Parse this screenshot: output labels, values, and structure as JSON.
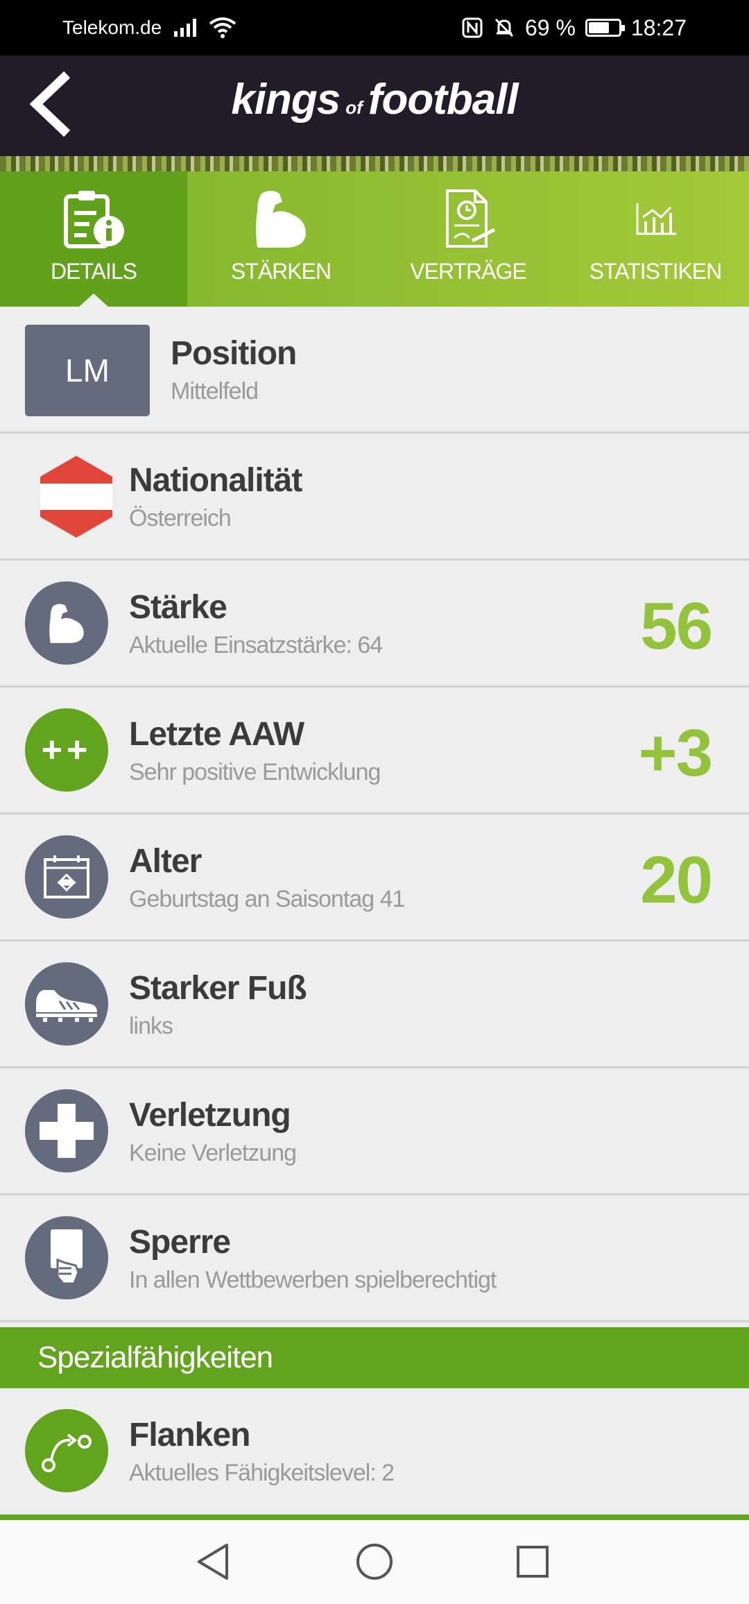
{
  "status_bar": {
    "carrier": "Telekom.de",
    "battery": "69 %",
    "battery_level": 0.69,
    "time": "18:27"
  },
  "header": {
    "brand_word1": "kings",
    "brand_word2": "of",
    "brand_word3": "football"
  },
  "tabs": [
    {
      "label": "DETAILS",
      "icon": "details-icon",
      "active": true
    },
    {
      "label": "STÄRKEN",
      "icon": "muscle-icon",
      "active": false
    },
    {
      "label": "VERTRÄGE",
      "icon": "contract-icon",
      "active": false
    },
    {
      "label": "STATISTIKEN",
      "icon": "chart-icon",
      "active": false
    }
  ],
  "rows": [
    {
      "badge": "LM",
      "title": "Position",
      "sub": "Mittelfeld"
    },
    {
      "title": "Nationalität",
      "sub": "Österreich",
      "icon": "austria-flag-icon"
    },
    {
      "title": "Stärke",
      "sub": "Aktuelle Einsatzstärke: 64",
      "value": "56",
      "icon": "muscle-icon"
    },
    {
      "title": "Letzte AAW",
      "sub": "Sehr positive Entwicklung",
      "value": "+3",
      "icon_text": "++"
    },
    {
      "title": "Alter",
      "sub": "Geburtstag an Saisontag 41",
      "value": "20",
      "icon": "calendar-icon"
    },
    {
      "title": "Starker Fuß",
      "sub": "links",
      "icon": "football-boot-icon"
    },
    {
      "title": "Verletzung",
      "sub": "Keine Verletzung",
      "icon": "plus-icon"
    },
    {
      "title": "Sperre",
      "sub": "In allen Wettbewerben spielberechtigt",
      "icon": "card-hand-icon"
    }
  ],
  "section": {
    "label": "Spezialfähigkeiten"
  },
  "special": {
    "title": "Flanken",
    "sub": "Aktuelles Fähigkeitslevel: 2",
    "icon": "cross-path-icon"
  },
  "colors": {
    "header_bg": "#221c2a",
    "accent_green": "#63a41e",
    "value_green": "#93c23b",
    "icon_grey": "#646b7d",
    "austria_red": "#e0463a"
  },
  "navbar": {
    "back": "back-triangle-icon",
    "home": "home-circle-icon",
    "recents": "recents-square-icon"
  }
}
